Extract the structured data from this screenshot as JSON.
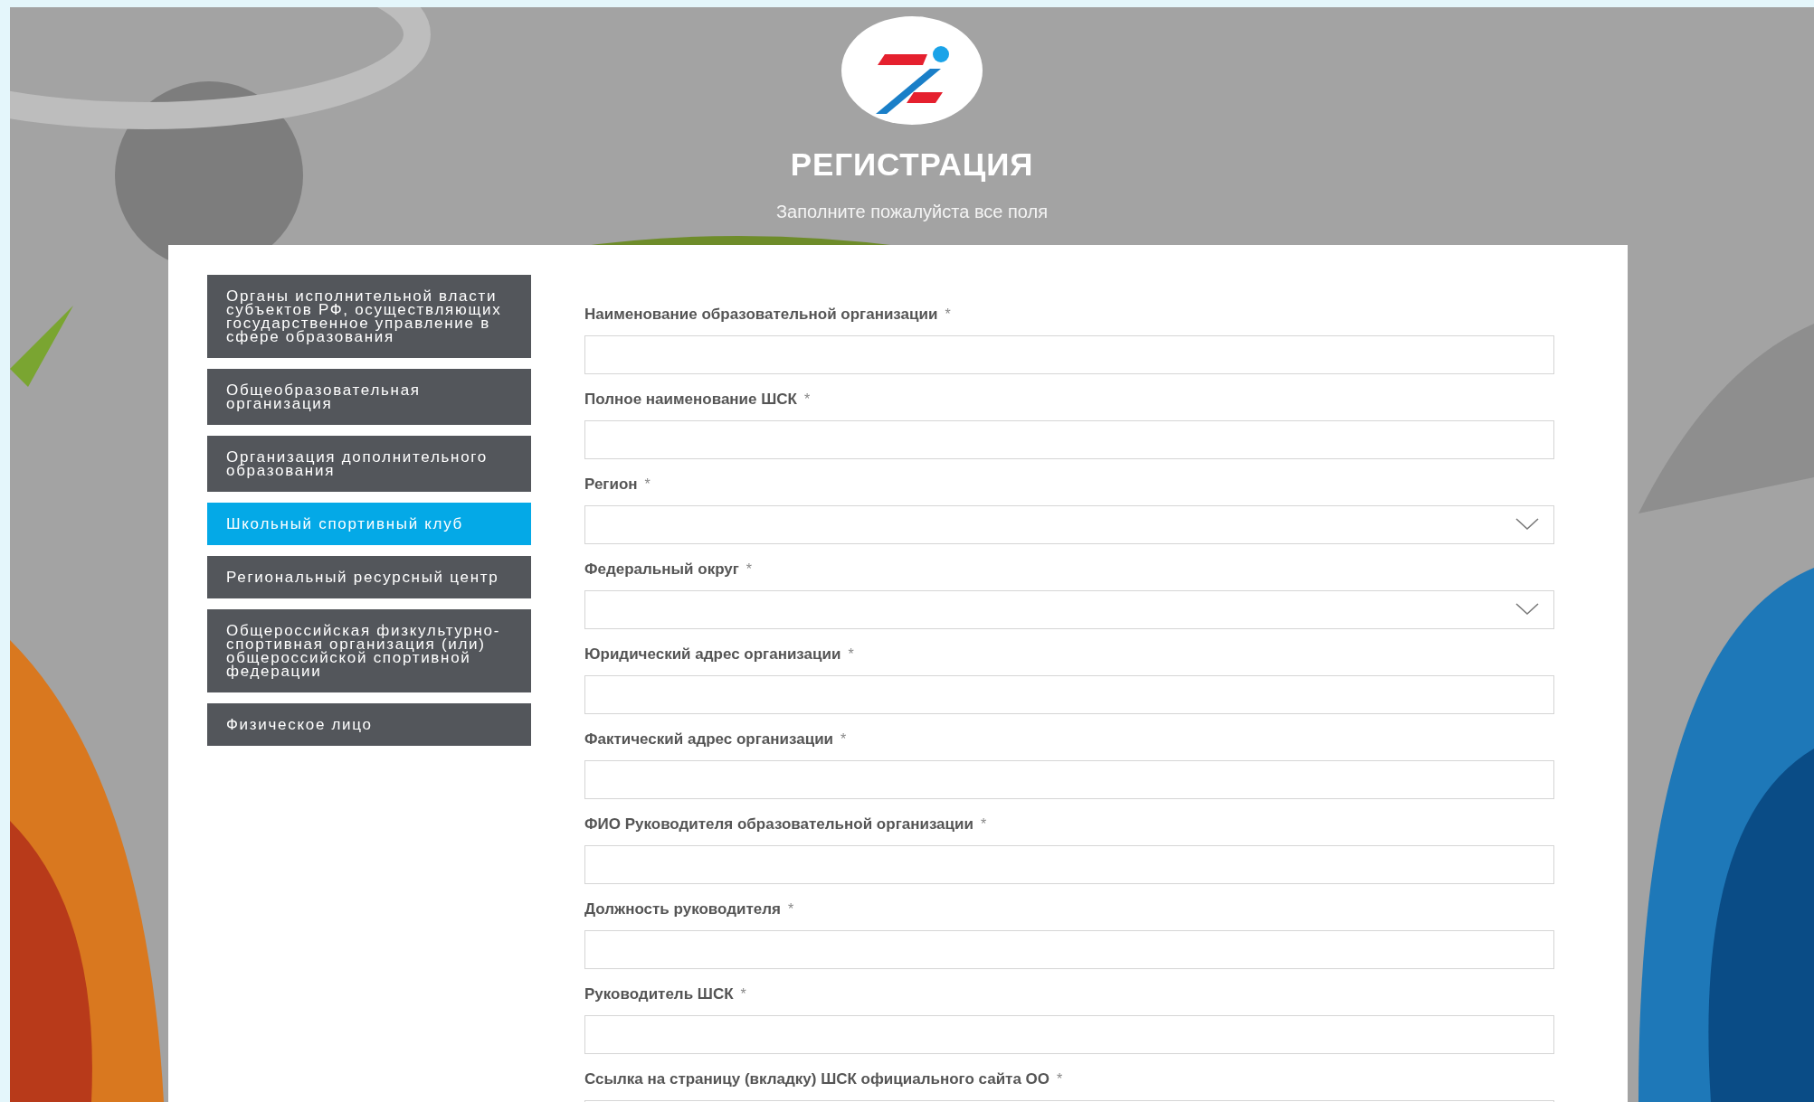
{
  "header": {
    "title": "РЕГИСТРАЦИЯ",
    "subtitle": "Заполните пожалуйста все поля"
  },
  "sidebar": {
    "items": [
      {
        "label": "Органы исполнительной власти субъектов РФ, осуществляющих государственное управление в сфере образования",
        "selected": false
      },
      {
        "label": "Общеобразовательная организация",
        "selected": false
      },
      {
        "label": "Организация дополнительного образования",
        "selected": false
      },
      {
        "label": "Школьный спортивный клуб",
        "selected": true
      },
      {
        "label": "Региональный ресурсный центр",
        "selected": false
      },
      {
        "label": "Общероссийская физкультурно-спортивная организация (или) общероссийской спортивной федерации",
        "selected": false
      },
      {
        "label": "Физическое лицо",
        "selected": false
      }
    ]
  },
  "form": {
    "fields": [
      {
        "kind": "text",
        "label": "Наименование образовательной организации",
        "required_mark": "*"
      },
      {
        "kind": "text",
        "label": "Полное наименование ШСК",
        "required_mark": "*"
      },
      {
        "kind": "select",
        "label": "Регион",
        "required_mark": "*"
      },
      {
        "kind": "select",
        "label": "Федеральный округ",
        "required_mark": "*"
      },
      {
        "kind": "text",
        "label": "Юридический адрес организации",
        "required_mark": "*"
      },
      {
        "kind": "text",
        "label": "Фактический адрес организации",
        "required_mark": "*"
      },
      {
        "kind": "text",
        "label": "ФИО Руководителя образовательной организации",
        "required_mark": "*"
      },
      {
        "kind": "text",
        "label": "Должность руководителя",
        "required_mark": "*"
      },
      {
        "kind": "text",
        "label": "Руководитель ШСК",
        "required_mark": "*"
      },
      {
        "kind": "text",
        "label": "Ссылка на страницу (вкладку) ШСК официального сайта ОО",
        "required_mark": "*"
      }
    ]
  }
}
